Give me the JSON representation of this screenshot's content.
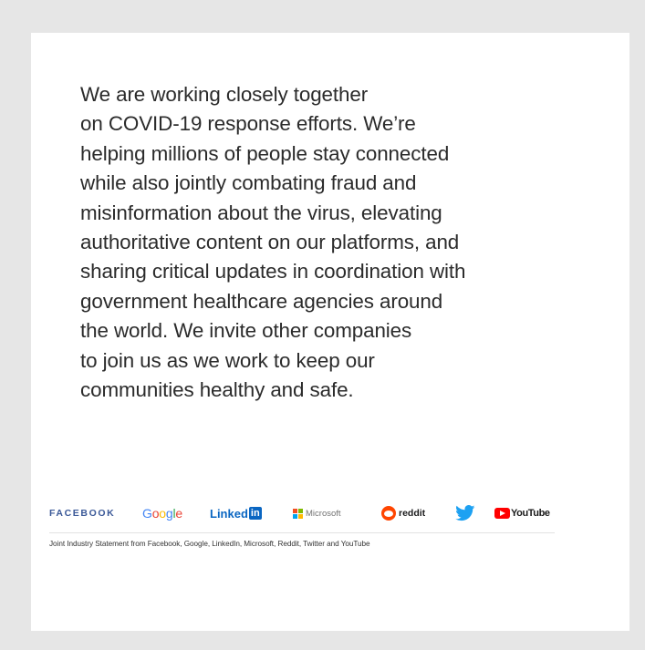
{
  "statement": {
    "lines": [
      "We are working closely together",
      "on COVID-19 response efforts. We’re",
      "helping millions of people stay connected",
      "while also jointly combating fraud and",
      "misinformation about the virus, elevating",
      "authoritative content on our platforms, and",
      "sharing critical updates in coordination with",
      "government healthcare agencies around",
      "the world. We invite other companies",
      "to join us as we work to keep our",
      "communities healthy and safe."
    ]
  },
  "logos": {
    "facebook": "FACEBOOK",
    "google": [
      "G",
      "o",
      "o",
      "g",
      "l",
      "e"
    ],
    "linkedin_text": "Linked",
    "linkedin_box": "in",
    "microsoft": "Microsoft",
    "reddit": "reddit",
    "twitter_icon": "twitter-bird-icon",
    "youtube": "YouTube"
  },
  "colors": {
    "background": "#e6e6e6",
    "card": "#ffffff",
    "text": "#2b2b2b",
    "facebook_blue": "#3b5998",
    "google": [
      "#4285f4",
      "#ea4335",
      "#fbbc05",
      "#4285f4",
      "#34a853",
      "#ea4335"
    ],
    "linkedin_blue": "#0a66c2",
    "microsoft": [
      "#f25022",
      "#7fba00",
      "#00a4ef",
      "#ffb900"
    ],
    "reddit_orange": "#ff4500",
    "twitter_blue": "#1da1f2",
    "youtube_red": "#ff0000"
  },
  "caption": "Joint Industry Statement from Facebook, Google, LinkedIn, Microsoft, Reddit, Twitter and YouTube"
}
